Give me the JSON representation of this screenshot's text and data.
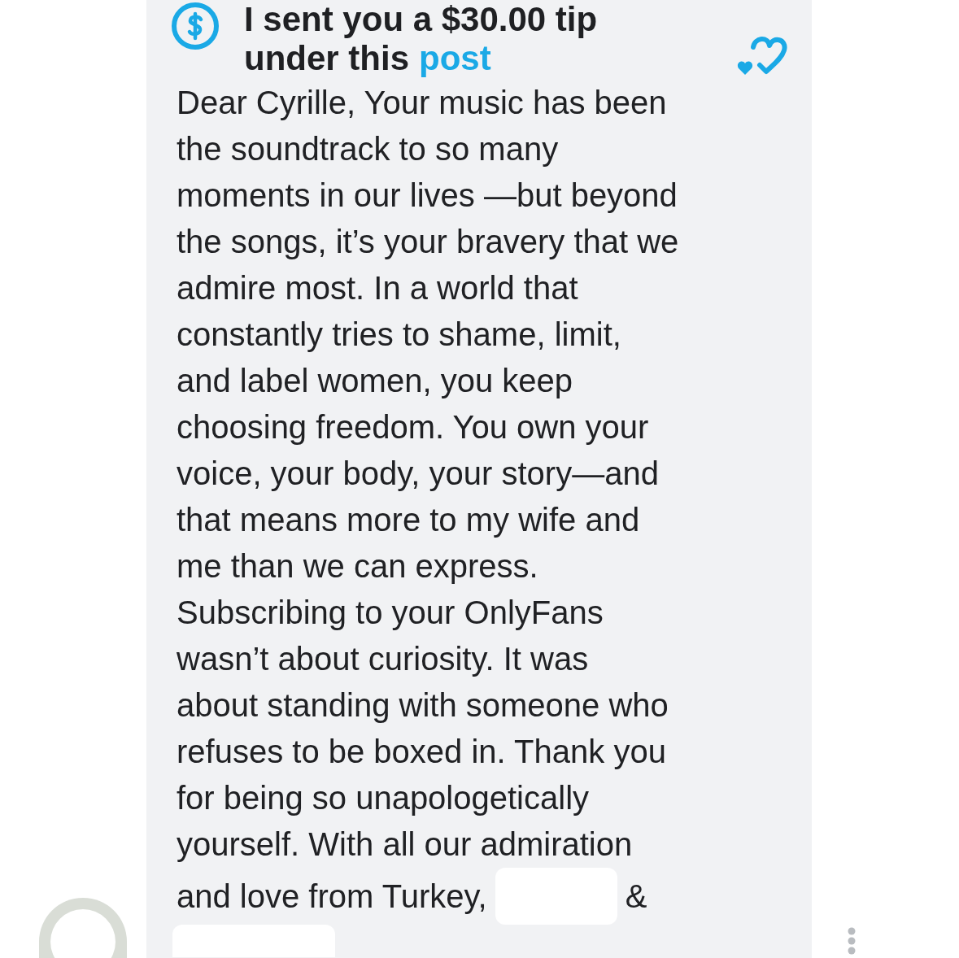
{
  "message": {
    "tip_title": "I sent you a $30.00 tip",
    "tip_title_end": "under this",
    "tip_link": "post",
    "body": "Dear Cyrille, Your music has been\nthe soundtrack to so many\nmoments in our lives —but beyond\nthe songs, it’s your bravery that we\nadmire most. In a world that\nconstantly tries to shame, limit,\nand label women, you keep\nchoosing freedom. You own your\nvoice, your body, your story—and\nthat means more to my wife and\nme than we can express.\nSubscribing to your OnlyFans\nwasn’t about curiosity. It was\nabout standing with someone who\nrefuses to be boxed in. Thank you\nfor being so unapologetically\nyourself. With all our admiration",
    "last_line_start": "and love from Turkey,",
    "last_line_end": "&"
  }
}
